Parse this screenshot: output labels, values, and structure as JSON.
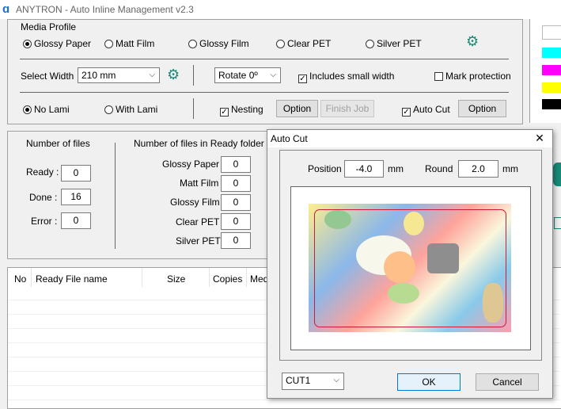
{
  "app": {
    "title": "ANYTRON - Auto Inline Management v2.3",
    "logo": "ɑ"
  },
  "media_profile": {
    "label": "Media Profile",
    "media_options": [
      {
        "label": "Glossy Paper",
        "selected": true
      },
      {
        "label": "Matt Film",
        "selected": false
      },
      {
        "label": "Glossy Film",
        "selected": false
      },
      {
        "label": "Clear PET",
        "selected": false
      },
      {
        "label": "Silver PET",
        "selected": false
      }
    ],
    "select_width_label": "Select Width",
    "width_value": "210 mm",
    "rotate_value": "Rotate 0º",
    "includes_small_width": {
      "label": "Includes small width",
      "checked": true
    },
    "mark_protection": {
      "label": "Mark protection",
      "checked": false
    },
    "lami_options": [
      {
        "label": "No Lami",
        "selected": true
      },
      {
        "label": "With Lami",
        "selected": false
      }
    ],
    "nesting": {
      "label": "Nesting",
      "checked": true
    },
    "option_button": "Option",
    "finish_job_button": "Finish Job",
    "auto_cut": {
      "label": "Auto Cut",
      "checked": true
    },
    "option_button_2": "Option"
  },
  "color_swatches": [
    "#00ffff",
    "#ff00ff",
    "#ffff00",
    "#000000"
  ],
  "counts": {
    "number_of_files_label": "Number of files",
    "ready_label": "Ready :",
    "ready_value": "0",
    "done_label": "Done :",
    "done_value": "16",
    "error_label": "Error :",
    "error_value": "0",
    "ready_folder_label": "Number of files in Ready folder",
    "folder_rows": [
      {
        "label": "Glossy Paper",
        "value": "0"
      },
      {
        "label": "Matt Film",
        "value": "0"
      },
      {
        "label": "Glossy Film",
        "value": "0"
      },
      {
        "label": "Clear PET",
        "value": "0"
      },
      {
        "label": "Silver PET",
        "value": "0"
      }
    ]
  },
  "table": {
    "columns": [
      "No",
      "Ready File name",
      "Size",
      "Copies",
      "Med"
    ]
  },
  "dialog": {
    "title": "Auto Cut",
    "close": "✕",
    "position_label": "Position",
    "position_value": "-4.0",
    "position_unit": "mm",
    "round_label": "Round",
    "round_value": "2.0",
    "round_unit": "mm",
    "cut_select": "CUT1",
    "ok_button": "OK",
    "cancel_button": "Cancel"
  }
}
